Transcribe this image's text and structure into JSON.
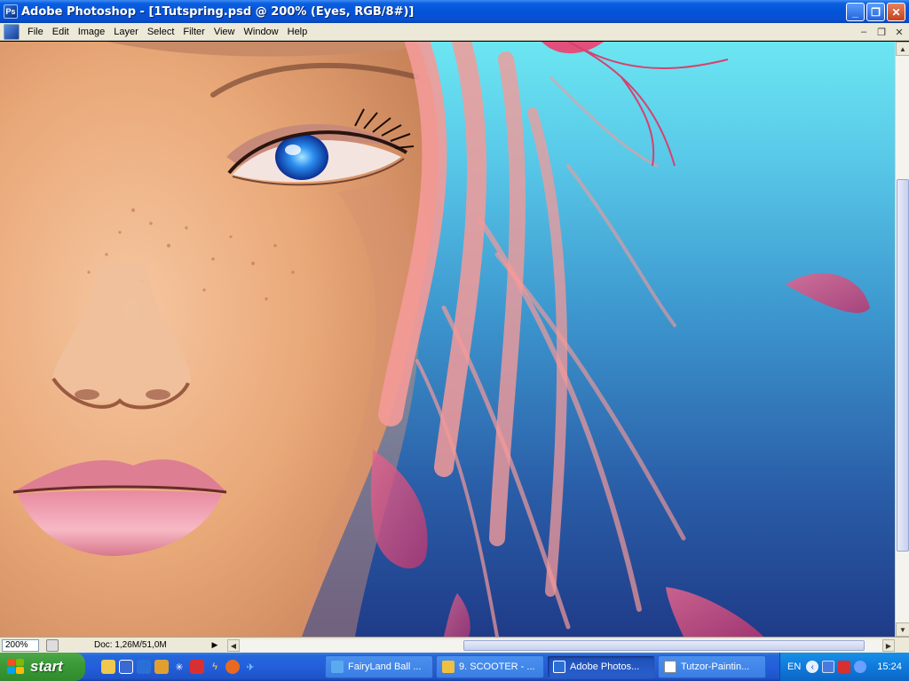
{
  "window": {
    "title": "Adobe Photoshop - [1Tutspring.psd @ 200% (Eyes, RGB/8#)]",
    "minimize_glyph": "_",
    "maximize_glyph": "❐",
    "close_glyph": "✕"
  },
  "menu": {
    "items": [
      "File",
      "Edit",
      "Image",
      "Layer",
      "Select",
      "Filter",
      "View",
      "Window",
      "Help"
    ]
  },
  "document_controls": {
    "minimize_glyph": "–",
    "restore_glyph": "❐",
    "close_glyph": "✕"
  },
  "status": {
    "zoom": "200%",
    "doc_info": "Doc: 1,26M/51,0M",
    "arrow_glyph": "▶"
  },
  "taskbar": {
    "start_label": "start",
    "tasks": [
      {
        "label": "FairyLand Ball ...",
        "icon_color": "#5aaaf0"
      },
      {
        "label": "9. SCOOTER - ...",
        "icon_color": "#f0c040"
      },
      {
        "label": "Adobe Photos...",
        "icon_color": "#2a6fd6"
      },
      {
        "label": "Tutzor-Paintin...",
        "icon_color": "#ffffff"
      }
    ],
    "tray": {
      "language": "EN",
      "clock": "15:24"
    }
  },
  "icons": {
    "app": "photoshop-icon",
    "quick_launch": [
      "folder-icon",
      "media-player-icon",
      "browser-icon",
      "winamp-icon",
      "snowflake-icon",
      "antivirus-icon",
      "lightning-icon",
      "firefox-icon",
      "bird-icon"
    ]
  },
  "colors": {
    "title_bar": "#0453d8",
    "menu_bar": "#ece9d8",
    "start_button": "#3c9a38",
    "taskbar": "#245edb",
    "sky_top": "#6ce6f2",
    "sky_bottom": "#1f3b88",
    "hair": "#f28d8d",
    "petal": "#d9508a"
  }
}
